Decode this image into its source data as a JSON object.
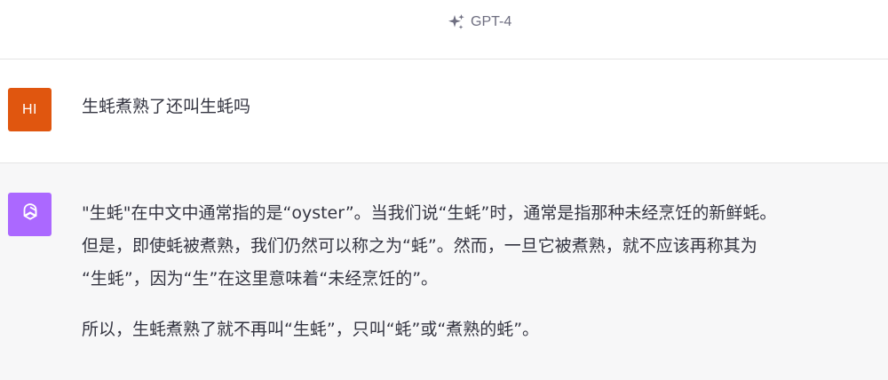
{
  "header": {
    "model_label": "GPT-4",
    "model_icon": "sparkle-icon"
  },
  "user_message": {
    "avatar_initials": "HI",
    "avatar_color": "#e0560f",
    "text": "生蚝煮熟了还叫生蚝吗"
  },
  "assistant_message": {
    "avatar_icon": "openai-logo-icon",
    "avatar_color": "#ab68ff",
    "paragraph1_lines": [
      "\"生蚝\"在中文中通常指的是“oyster”。当我们说“生蚝”时，通常是指那种未经烹饪的新鲜蚝。",
      "但是，即使蚝被煮熟，我们仍然可以称之为“蚝”。然而，一旦它被煮熟，就不应该再称其为",
      "“生蚝”，因为“生”在这里意味着“未经烹饪的”。"
    ],
    "paragraph2": "所以，生蚝煮熟了就不再叫“生蚝”，只叫“蚝”或“煮熟的蚝”。"
  }
}
